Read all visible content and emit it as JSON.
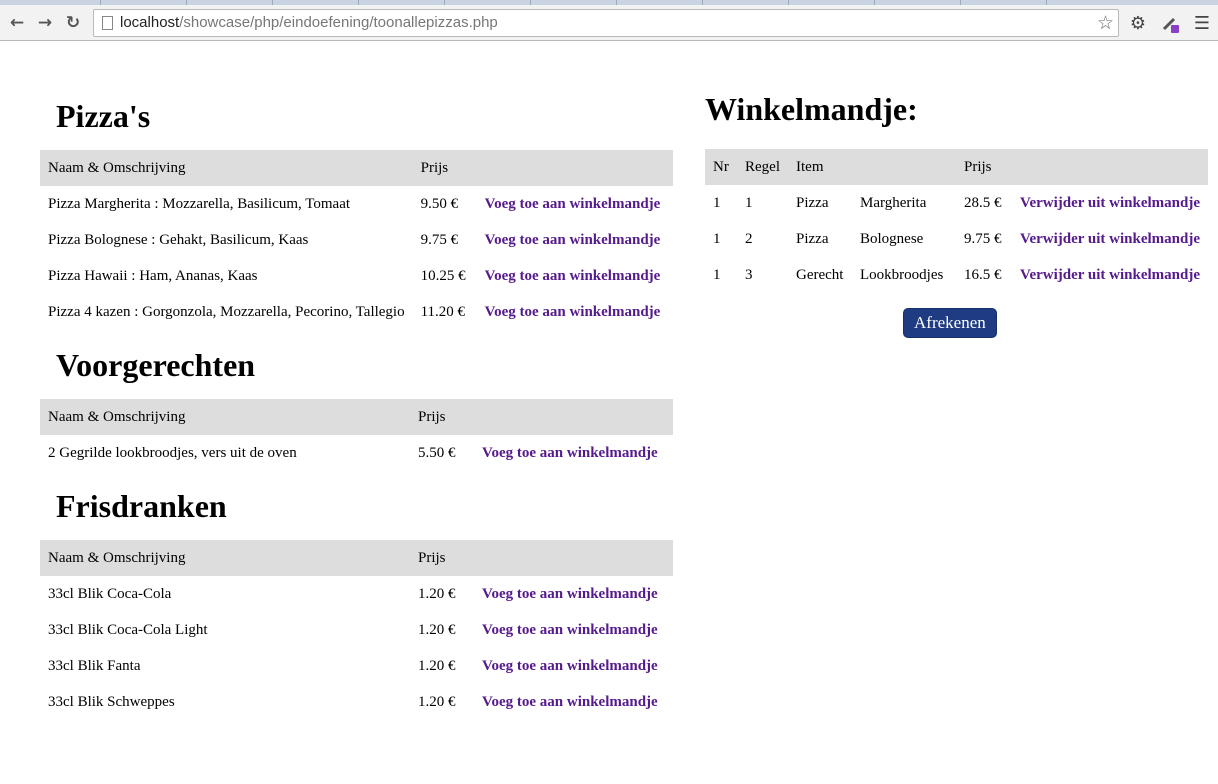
{
  "browser": {
    "url_host": "localhost",
    "url_path": "/showcase/php/eindoefening/toonallepizzas.php",
    "icons": {
      "back": "arrow-left-icon",
      "forward": "arrow-right-icon",
      "reload": "reload-icon",
      "page": "page-icon",
      "bookmark": "star-icon",
      "settings": "gear-icon",
      "extension": "eyedropper-icon",
      "menu": "hamburger-menu-icon"
    }
  },
  "colors": {
    "header_bg": "#dddddd",
    "link": "#551a8b",
    "button_bg": "#1f3c82",
    "button_text": "#ffffff"
  },
  "menu": {
    "add_label": "Voeg toe aan winkelmandje",
    "sections": [
      {
        "title": "Pizza's",
        "headers": [
          "Naam & Omschrijving",
          "Prijs"
        ],
        "rows": [
          {
            "name": "Pizza Margherita : Mozzarella, Basilicum, Tomaat",
            "price": "9.50 €"
          },
          {
            "name": "Pizza Bolognese : Gehakt, Basilicum, Kaas",
            "price": "9.75 €"
          },
          {
            "name": "Pizza Hawaii : Ham, Ananas, Kaas",
            "price": "10.25 €"
          },
          {
            "name": "Pizza 4 kazen : Gorgonzola, Mozzarella, Pecorino, Tallegio",
            "price": "11.20 €"
          }
        ]
      },
      {
        "title": "Voorgerechten",
        "headers": [
          "Naam & Omschrijving",
          "Prijs"
        ],
        "rows": [
          {
            "name": "2 Gegrilde lookbroodjes, vers uit de oven",
            "price": "5.50 €"
          }
        ]
      },
      {
        "title": "Frisdranken",
        "headers": [
          "Naam & Omschrijving",
          "Prijs"
        ],
        "rows": [
          {
            "name": "33cl Blik Coca-Cola",
            "price": "1.20 €"
          },
          {
            "name": "33cl Blik Coca-Cola Light",
            "price": "1.20 €"
          },
          {
            "name": "33cl Blik Fanta",
            "price": "1.20 €"
          },
          {
            "name": "33cl Blik Schweppes",
            "price": "1.20 €"
          }
        ]
      }
    ]
  },
  "cart": {
    "title": "Winkelmandje:",
    "headers": [
      "Nr",
      "Regel",
      "Item",
      "",
      "Prijs"
    ],
    "remove_label": "Verwijder uit winkelmandje",
    "rows": [
      {
        "nr": "1",
        "regel": "1",
        "type": "Pizza",
        "name": "Margherita",
        "price": "28.5 €"
      },
      {
        "nr": "1",
        "regel": "2",
        "type": "Pizza",
        "name": "Bolognese",
        "price": "9.75 €"
      },
      {
        "nr": "1",
        "regel": "3",
        "type": "Gerecht",
        "name": "Lookbroodjes",
        "price": "16.5 €"
      }
    ],
    "checkout_label": "Afrekenen"
  }
}
